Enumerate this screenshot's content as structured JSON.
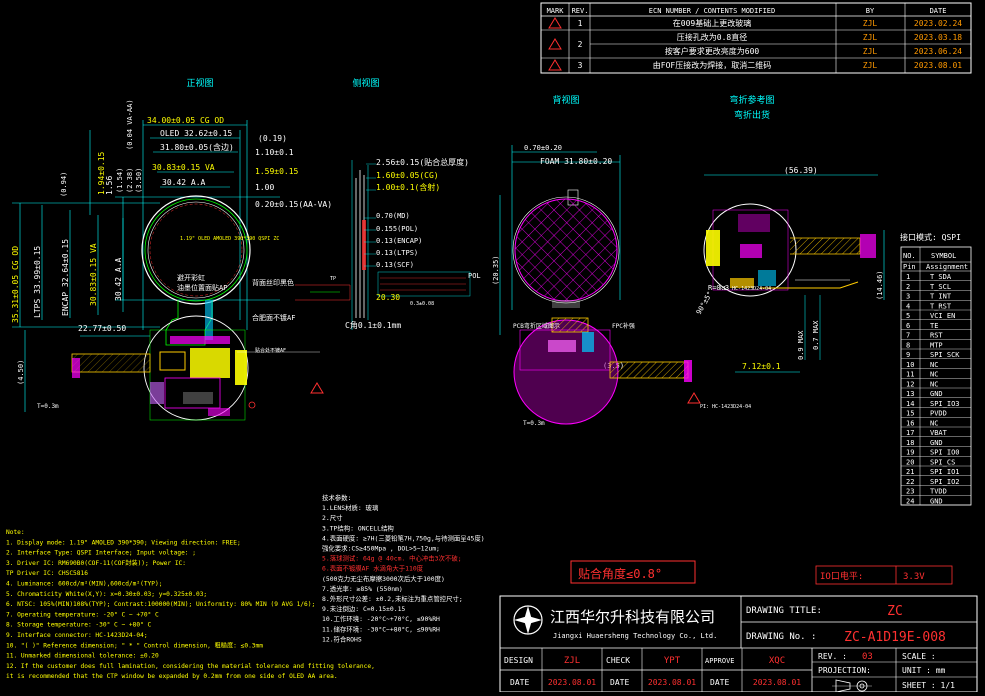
{
  "revisions": {
    "headers": [
      "MARK",
      "REV.",
      "ECN NUMBER / CONTENTS MODIFIED",
      "BY",
      "DATE"
    ],
    "rows": [
      {
        "rev": "1",
        "content": "在009基础上更改玻璃",
        "by": "ZJL",
        "date": "2023.02.24"
      },
      {
        "rev": "2",
        "content": "压接孔改为0.8直径",
        "by": "ZJL",
        "date": "2023.03.18"
      },
      {
        "rev": "",
        "content": "按客户要求更改亮度为600",
        "by": "ZJL",
        "date": "2023.06.24"
      },
      {
        "rev": "3",
        "content": "由FOF压接改为焊接，取消二维码",
        "by": "ZJL",
        "date": "2023.08.01"
      }
    ]
  },
  "views": {
    "front": "正视图",
    "side": "侧视图",
    "back": "背视图",
    "bend": "弯折参考图",
    "bend_sub": "弯折出货"
  },
  "front_dims": {
    "d1": "34.00±0.05 CG OD",
    "d2": "OLED 32.62±0.15",
    "d3": "31.80±0.05(含边)",
    "d4": "30.83±0.15 VA",
    "d5": "30.42 A.A",
    "d6": "(0.19)",
    "d7": "1.10±0.1",
    "d8": "1.59±0.15",
    "d9": "1.00",
    "d10": "0.20±0.15(AA-VA)",
    "d11": "(0.94)",
    "d12": "(1.54)",
    "d13": "(2.38)",
    "d14": "(3.50)",
    "d15": "1.94±0.15",
    "d16": "1.56",
    "d17": "(0.04 VA-AA)",
    "v1": "35.31±0.05 CG OD",
    "v2": "LTPS 33.99±0.15",
    "v3": "ENCAP 32.64±0.15",
    "v4": "30.83±0.15 VA",
    "v5": "30.42 A.A",
    "v6": "(4.50)",
    "fpc": "22.77±0.50",
    "pitch": "T=0.3m",
    "label_panel": "1.19\" OLED\nAMOLED\n390*390\nQSPI\nZC",
    "note_rainbow": "避开彩虹",
    "note_side": "背面丝印黑色",
    "note_ink": "油墨位置面贴AP",
    "note_glue": "合肥面不镀AF",
    "tag_bottom": "贴合处不镀AF"
  },
  "side_dims": {
    "s1": "2.56±0.15(贴合总厚度)",
    "s2": "1.60±0.05(CG)",
    "s3": "1.00±0.1(含射)",
    "s4": "0.70(MD)",
    "s5": "0.155(POL)",
    "s6": "0.13(ENCAP)",
    "s7": "0.13(LTPS)",
    "s8": "0.13(SCF)",
    "s9": "20.30",
    "s10": "C角0.1±0.1mm",
    "s11": "TP",
    "s12": "POL",
    "s13": "0.3±0.08"
  },
  "back_dims": {
    "b1": "0.70±0.20",
    "b2": "FOAM 31.80±0.20",
    "b3": "(20.35)",
    "b4": "(3.5)",
    "note_pcb": "PCB弯折区域图示",
    "note_fpc": "FPC补强",
    "pitch": "T=0.3m",
    "tag": "PI: HC-1423D24-04"
  },
  "bend_dims": {
    "w1": "(56.39)",
    "w2": "(14.46)",
    "w3": "0.9 MAX",
    "w4": "0.7 MAX",
    "w5": "7.12±0.1",
    "w6": "R=0.3",
    "w7": "90°±5°",
    "tag": "PI: HC-1423D24-04"
  },
  "pins": {
    "title": "接口模式: QSPI",
    "headers": [
      "Pin",
      "Assignment"
    ],
    "col_header": [
      "NO.",
      "SYMBOL"
    ],
    "rows": [
      [
        "1",
        "T_SDA"
      ],
      [
        "2",
        "T_SCL"
      ],
      [
        "3",
        "T_INT"
      ],
      [
        "4",
        "T_RST"
      ],
      [
        "5",
        "VCI_EN"
      ],
      [
        "6",
        "TE"
      ],
      [
        "7",
        "RST"
      ],
      [
        "8",
        "MTP"
      ],
      [
        "9",
        "SPI_SCK"
      ],
      [
        "10",
        "NC"
      ],
      [
        "11",
        "NC"
      ],
      [
        "12",
        "NC"
      ],
      [
        "13",
        "GND"
      ],
      [
        "14",
        "SPI_IO3"
      ],
      [
        "15",
        "PVDD"
      ],
      [
        "16",
        "NC"
      ],
      [
        "17",
        "VBAT"
      ],
      [
        "18",
        "GND"
      ],
      [
        "19",
        "SPI_IO0"
      ],
      [
        "20",
        "SPI_CS"
      ],
      [
        "21",
        "SPI_IO1"
      ],
      [
        "22",
        "SPI_IO2"
      ],
      [
        "23",
        "TVDD"
      ],
      [
        "24",
        "GND"
      ]
    ]
  },
  "notes": [
    "Note:",
    "1. Display mode: 1.19\" AMOLED 390*390;   Viewing direction: FREE;",
    "2. Interface Type: QSPI Interface;  Input voltage:   ;",
    "3. Driver IC: RM690B0(COF-11(COF封装)); Power IC:",
    "   TP Driver IC: CHSC5816",
    "4. Luminance: 600cd/m²(MIN),600cd/m²(TYP);",
    "5. Chromaticity White(X,Y): x=0.30±0.03; y=0.325±0.03;",
    "6. NTSC: 105%(MIN)108%(TYP); Contrast:100000(MIN); Uniformity: 80% MIN (9 AVG 1/6);",
    "7. Operating temperature: -20° C ~ +70° C",
    "8. Storage temperature: -30° C ~ +80° C",
    "9. Interface connector: HC-1423D24-04;",
    "10. \"( )\" Reference dimension;  \" * \" Control dimension, 粗糙度: ≤0.3mm",
    "11. Unmarked dimensional tolerance: ±0.20",
    "12. If the customer does full lamination, considering the material tolerance and fitting tolerance,",
    "    it is recommended that the CTP window be expanded by 0.2mm from one side of OLED AA area."
  ],
  "tech": [
    "技术参数:",
    "1.LENS材质: 玻璃",
    "2.尺寸",
    "3.TP结构: ONCELL结构",
    "4.表面硬度: ≥7H(三菱铅笔7H,750g,与待测面呈45度)",
    "  强化要求:CS≥450Mpa , DOL>5~12um;",
    "5.落球测试: 64g @ 40cm. 中心冲击3次不破;",
    "6.表面不镀膜AF 水滴角大于110度",
    "  (500克力无尘布摩擦3000次后大于100度)",
    "7.透光率: ≥85% (550nm)",
    "8.外形尺寸公差: ±0.2,未标注为重点管控尺寸;",
    "9.未注倒边: C=0.15±0.15",
    "10.工作环境: -20°C~+70°C, ≤90%RH",
    "11.储存环境: -30°C~+80°C, ≤90%RH",
    "12.符合ROHS"
  ],
  "callouts": {
    "angle": "贴合角度≤0.8°",
    "io_label": "IO口电平:",
    "io_value": "3.3V"
  },
  "company": {
    "name_cn": "江西华尔升科技有限公司",
    "name_en": "Jiangxi Huaersheng Technology Co., Ltd."
  },
  "titleblock": {
    "drawing_title_label": "DRAWING  TITLE:",
    "drawing_title": "ZC",
    "drawing_no_label": "DRAWING  No. :",
    "drawing_no": "ZC-A1D19E-008",
    "rev_label": "REV. :",
    "rev": "03",
    "scale_label": "SCALE :",
    "projection_label": "PROJECTION:",
    "unit_label": "UNIT : mm",
    "sheet_label": "SHEET : 1/1",
    "design_label": "DESIGN",
    "design": "ZJL",
    "check_label": "CHECK",
    "check": "YPT",
    "approve_label": "APPROVE",
    "approve": "XQC",
    "date_label": "DATE",
    "date1": "2023.08.01",
    "date2": "2023.08.01",
    "date3": "2023.08.01"
  }
}
